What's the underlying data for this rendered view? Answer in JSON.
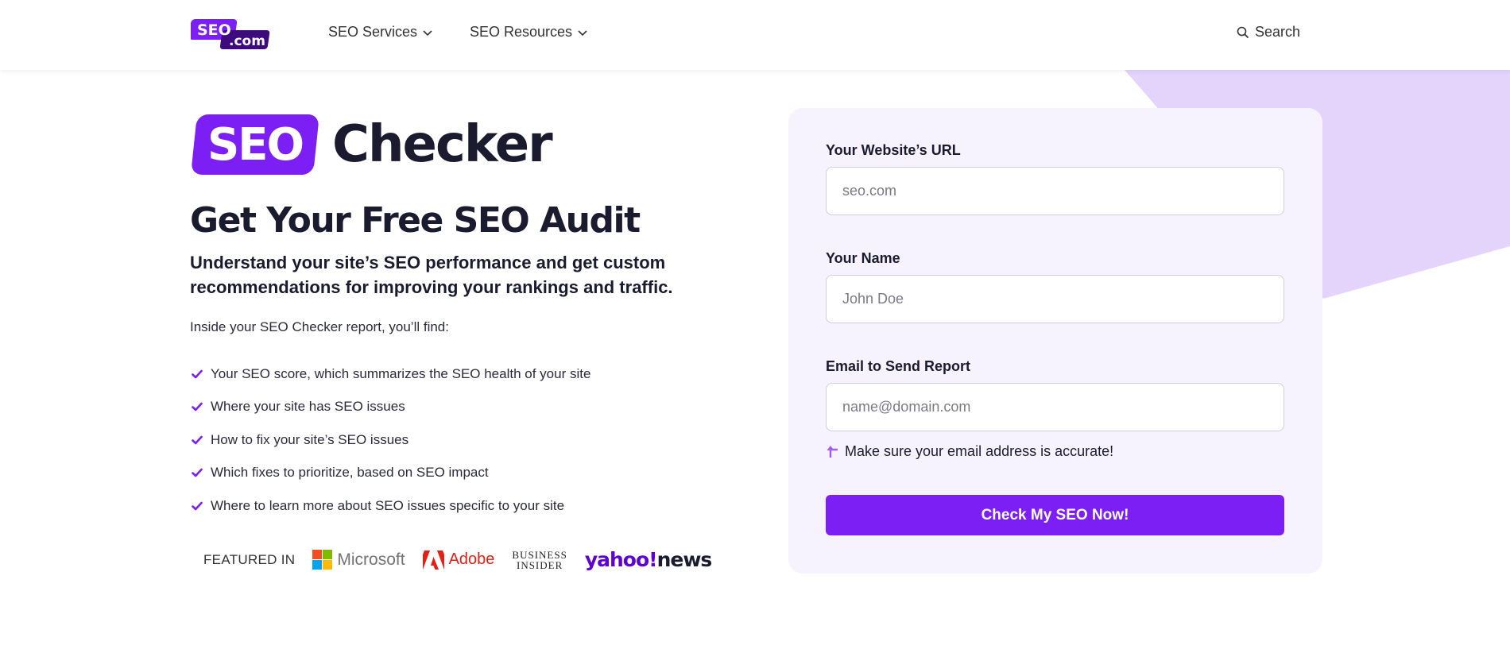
{
  "colors": {
    "brand_purple": "#7b1ff5",
    "shape_lavender": "#e4d4fc",
    "card_bg": "#f6f3fe",
    "text_dark": "#1b1b2f"
  },
  "header": {
    "logo_top": "SEO",
    "logo_bottom": ".com",
    "nav": [
      {
        "label": "SEO Services",
        "icon": "chevron-down-icon"
      },
      {
        "label": "SEO Resources",
        "icon": "chevron-down-icon"
      }
    ],
    "search_label": "Search"
  },
  "hero": {
    "badge": "SEO",
    "title_word": "Checker",
    "subtitle": "Get Your Free SEO Audit",
    "lead": "Understand your site’s SEO performance and get custom recommendations for improving your rankings and traffic.",
    "intro": "Inside your SEO Checker report, you’ll find:",
    "features": [
      "Your SEO score, which summarizes the SEO health of your site",
      "Where your site has SEO issues",
      "How to fix your site’s SEO issues",
      "Which fixes to prioritize, based on SEO impact",
      "Where to learn more about SEO issues specific to your site"
    ],
    "featured_label": "FEATURED IN",
    "brands": {
      "microsoft": "Microsoft",
      "adobe": "Adobe",
      "bi_line1": "BUSINESS",
      "bi_line2": "INSIDER",
      "yahoo": "yahoo",
      "yahoo_mark": "!",
      "news": "news"
    }
  },
  "form": {
    "url_label": "Your Website’s URL",
    "url_placeholder": "seo.com",
    "name_label": "Your Name",
    "name_placeholder": "John Doe",
    "email_label": "Email to Send Report",
    "email_placeholder": "name@domain.com",
    "hint": "Make sure your email address is accurate!",
    "submit_label": "Check My SEO Now!"
  }
}
